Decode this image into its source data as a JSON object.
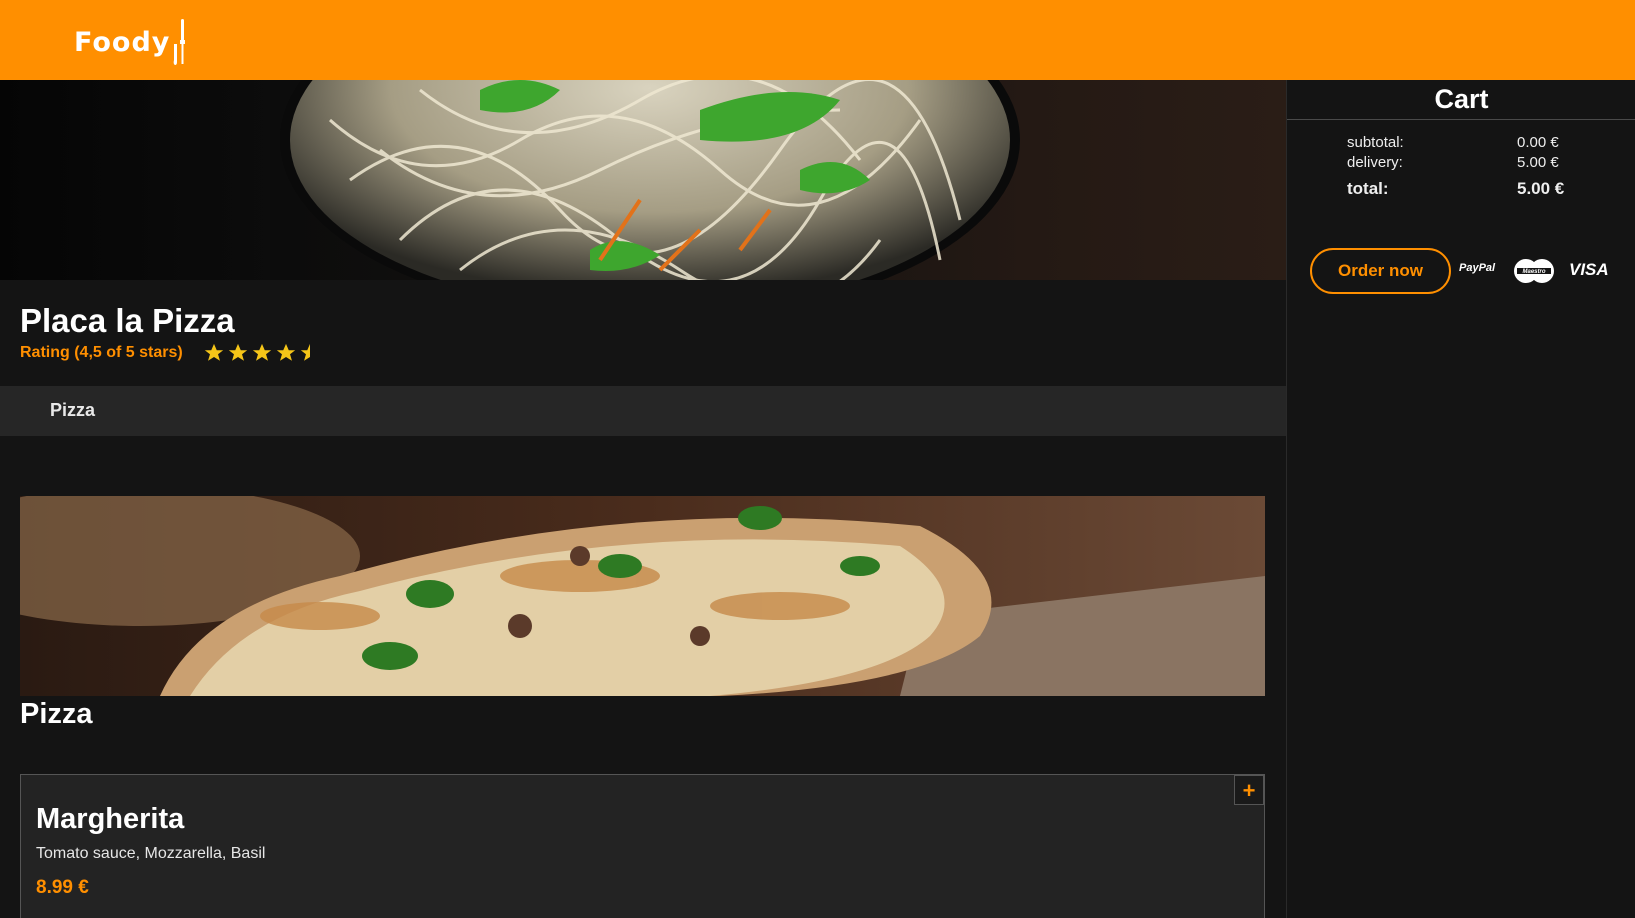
{
  "brand": {
    "logo_text": "Foody",
    "accent": "#ff8f00",
    "logo_icon": "fork-knife-icon"
  },
  "restaurant": {
    "name": "Placa la Pizza",
    "rating_label": "Rating (4,5 of 5 stars)",
    "rating": 4.5,
    "rating_max": 5,
    "hero_image": "noodles-bowl-image"
  },
  "category_nav": {
    "items": [
      {
        "label": "Pizza"
      }
    ]
  },
  "categories": [
    {
      "title": "Pizza",
      "banner_image": "pizza-on-peel-image",
      "dishes": [
        {
          "name": "Margherita",
          "description": "Tomato sauce, Mozzarella, Basil",
          "price": "8.99 €",
          "add_label": "+"
        }
      ]
    }
  ],
  "cart": {
    "title": "Cart",
    "subtotal_label": "subtotal:",
    "subtotal_value": "0.00 €",
    "delivery_label": "delivery:",
    "delivery_value": "5.00 €",
    "total_label": "total:",
    "total_value": "5.00 €",
    "order_button": "Order now",
    "payment_methods": {
      "paypal": "PayPal",
      "maestro": "Maestro",
      "visa": "VISA"
    }
  }
}
